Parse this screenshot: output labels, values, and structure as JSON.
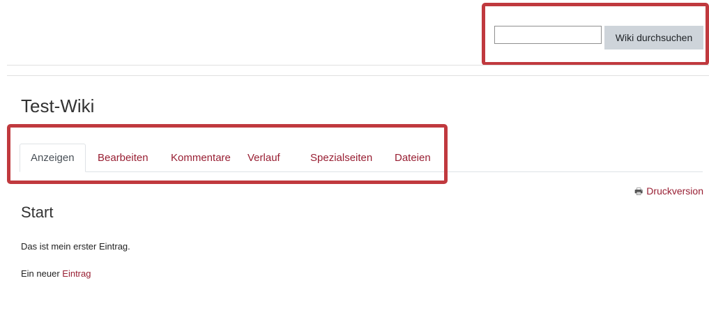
{
  "search": {
    "placeholder": "",
    "value": "",
    "button_label": "Wiki durchsuchen"
  },
  "page": {
    "title": "Test-Wiki"
  },
  "tabs": [
    {
      "label": "Anzeigen",
      "active": true
    },
    {
      "label": "Bearbeiten",
      "active": false
    },
    {
      "label": "Kommentare",
      "active": false
    },
    {
      "label": "Verlauf",
      "active": false
    },
    {
      "label": "Spezialseiten",
      "active": false
    },
    {
      "label": "Dateien",
      "active": false
    }
  ],
  "print": {
    "icon": "printer-icon",
    "label": "Druckversion"
  },
  "content": {
    "heading": "Start",
    "line1": "Das ist mein erster Eintrag.",
    "line2_prefix": "Ein neuer",
    "line2_link": "Eintrag"
  },
  "colors": {
    "link": "#981e32",
    "highlight": "#c0393e",
    "button_bg": "#ced4da"
  }
}
